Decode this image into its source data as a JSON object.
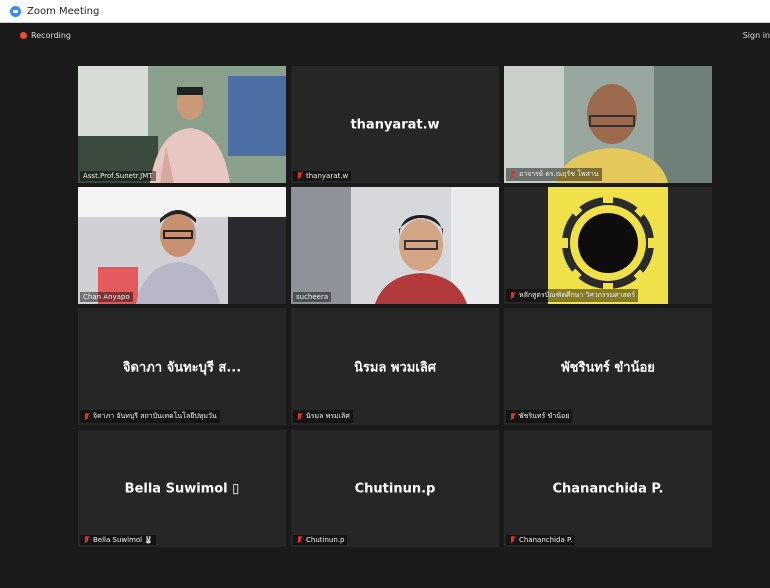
{
  "window": {
    "title": "Zoom Meeting"
  },
  "status": {
    "recording": "Recording",
    "sign_in": "Sign in"
  },
  "participants": [
    {
      "name": "Asst.Prof.Sunetr.JMT",
      "center": "",
      "video": true,
      "muted": false
    },
    {
      "name": "thanyarat.w",
      "center": "thanyarat.w",
      "video": false,
      "muted": true
    },
    {
      "name": "อาจารย์ ดร.ณฤรัช โพสาน",
      "center": "",
      "video": true,
      "muted": true
    },
    {
      "name": "Chan Anyapo",
      "center": "",
      "video": true,
      "muted": false,
      "active": true
    },
    {
      "name": "sucheera",
      "center": "",
      "video": true,
      "muted": false
    },
    {
      "name": "หลักสูตรบัณฑิตศึกษา วิศวกรรมศาสตร์",
      "center": "",
      "video": true,
      "muted": true
    },
    {
      "name": "จิดาภา จันทบุรี สถาบันเทคโนโลยีปทุมวัน",
      "center": "จิดาภา จันทะบุรี ส...",
      "video": false,
      "muted": true
    },
    {
      "name": "นิรมล พรมเลิศ",
      "center": "นิรมล พวมเลิศ",
      "video": false,
      "muted": true
    },
    {
      "name": "พัชรินทร์ ขำน้อย",
      "center": "พัชรินทร์ ขำน้อย",
      "video": false,
      "muted": true
    },
    {
      "name": "Bella Suwimol 🐰",
      "center": "Bella  Suwimol ▯",
      "video": false,
      "muted": true
    },
    {
      "name": "Chutinun.p",
      "center": "Chutinun.p",
      "video": false,
      "muted": true
    },
    {
      "name": "Chananchida P.",
      "center": "Chananchida P.",
      "video": false,
      "muted": true
    }
  ],
  "colors": {
    "active_border": "#c7e04a",
    "muted_mic": "#e03030",
    "tile_bg": "#262626"
  }
}
